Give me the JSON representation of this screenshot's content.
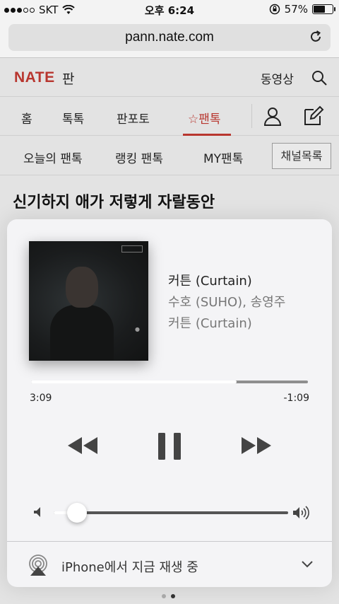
{
  "status_bar": {
    "carrier": "SKT",
    "time": "오후 6:24",
    "battery_percent": "57%",
    "battery_level": 0.57
  },
  "browser": {
    "url": "pann.nate.com"
  },
  "page": {
    "logo": "NATE",
    "logo_sub": "판",
    "video_link": "동영상",
    "nav_primary": [
      {
        "label": "홈"
      },
      {
        "label": "톡톡"
      },
      {
        "label": "판포토"
      },
      {
        "label": "☆팬톡"
      }
    ],
    "nav_secondary": [
      {
        "label": "오늘의 팬톡"
      },
      {
        "label": "랭킹 팬톡"
      },
      {
        "label": "MY팬톡"
      }
    ],
    "channel_button": "채널목록",
    "headline": "신기하지 애가 저렇게 자랄동안"
  },
  "player": {
    "song_title": "커튼 (Curtain)",
    "artist": "수호 (SUHO), 송영주",
    "album": "커튼 (Curtain)",
    "elapsed": "3:09",
    "remaining": "-1:09",
    "progress_fraction": 0.743,
    "volume_fraction": 0.1,
    "airplay_label": "iPhone에서 지금 재생 중"
  }
}
